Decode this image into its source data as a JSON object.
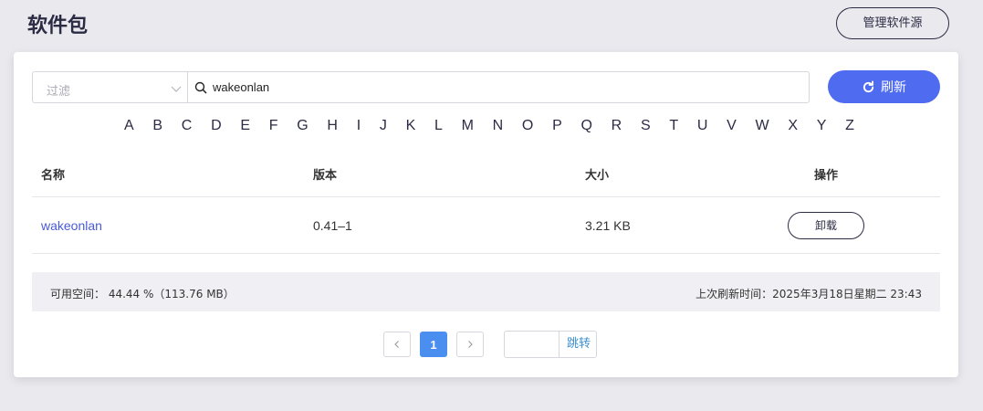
{
  "header": {
    "title": "软件包",
    "manage_button": "管理软件源"
  },
  "filter": {
    "select_placeholder": "过滤",
    "search_value": "wakeonlan",
    "refresh_label": "刷新"
  },
  "alphabet": [
    "A",
    "B",
    "C",
    "D",
    "E",
    "F",
    "G",
    "H",
    "I",
    "J",
    "K",
    "L",
    "M",
    "N",
    "O",
    "P",
    "Q",
    "R",
    "S",
    "T",
    "U",
    "V",
    "W",
    "X",
    "Y",
    "Z"
  ],
  "table": {
    "columns": [
      "名称",
      "版本",
      "大小",
      "操作"
    ],
    "rows": [
      {
        "name": "wakeonlan",
        "version": "0.41–1",
        "size": "3.21 KB",
        "action": "卸载"
      }
    ]
  },
  "status": {
    "free_space": "可用空间： 44.44 %（113.76 MB）",
    "last_refresh": "上次刷新时间：2025年3月18日星期二 23:43"
  },
  "pagination": {
    "current_page": "1",
    "jump_label": "跳转"
  },
  "icons": {
    "search": "search-icon",
    "chevron": "chevron-down-icon",
    "refresh": "refresh-icon",
    "prev": "chevron-left-icon",
    "next": "chevron-right-icon"
  },
  "colors": {
    "primary": "#4f6bf0",
    "link": "#4a5ad8",
    "page_active": "#4a8ff0",
    "title": "#2b2b44"
  }
}
